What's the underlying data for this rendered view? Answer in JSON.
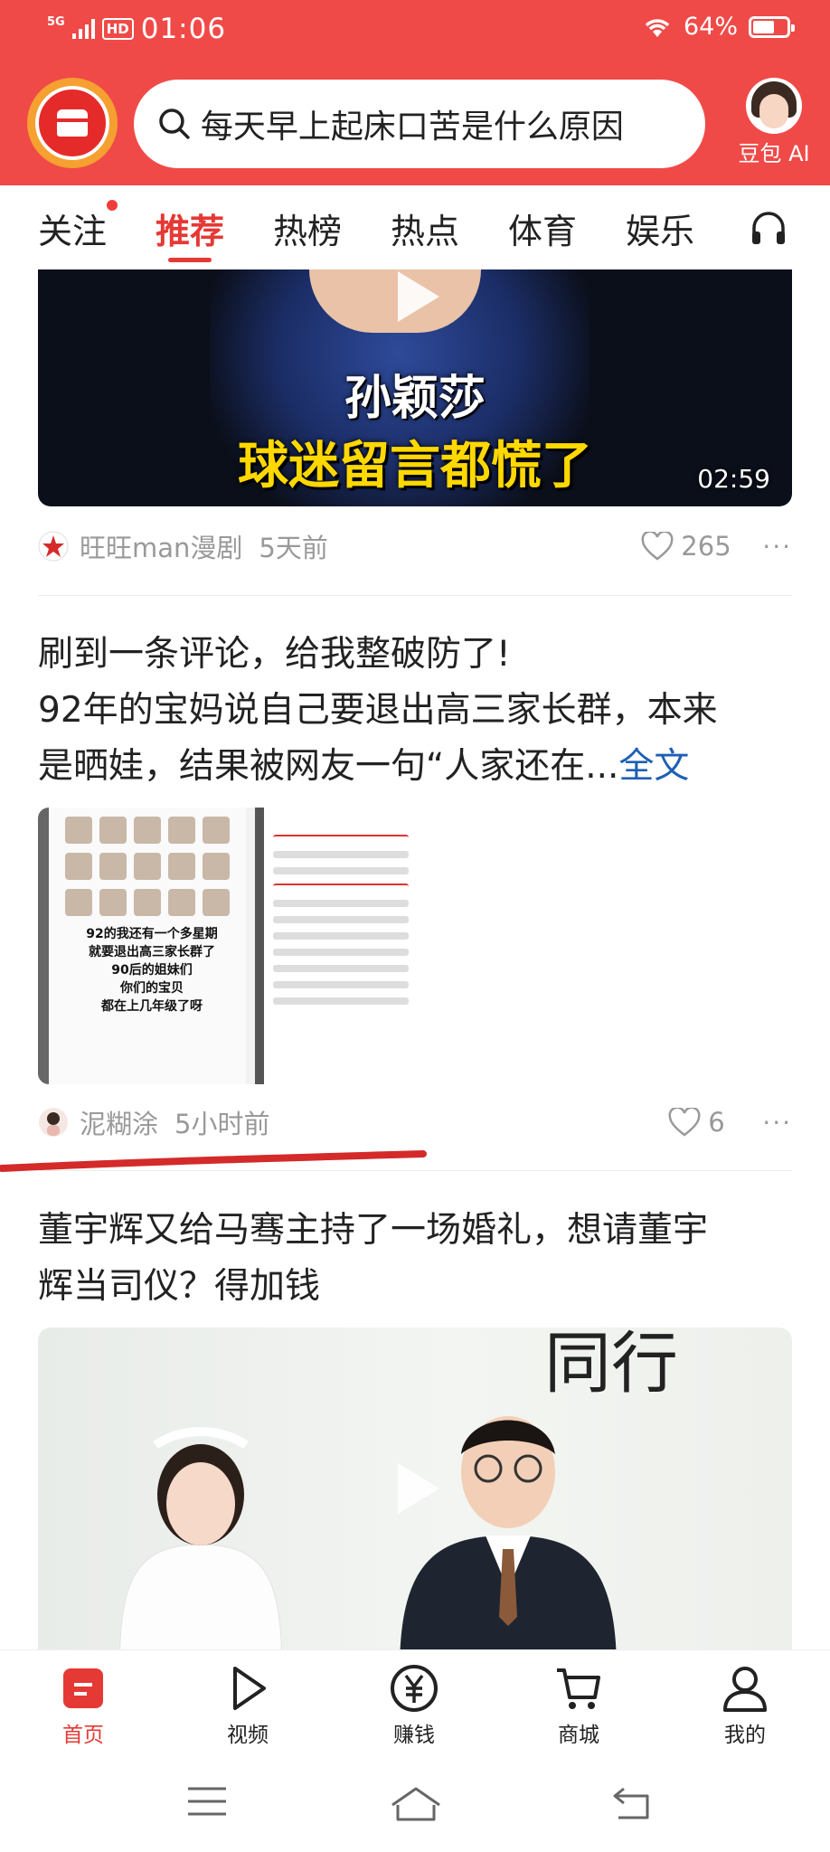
{
  "status_bar": {
    "network": "5G",
    "hd": "HD",
    "time": "01:06",
    "battery_percent": "64%",
    "battery_level": 0.64
  },
  "header": {
    "search_query": "每天早上起床口苦是什么原因",
    "ai_label": "豆包 AI"
  },
  "tabs": [
    {
      "label": "关注",
      "has_dot": true
    },
    {
      "label": "推荐",
      "active": true
    },
    {
      "label": "热榜"
    },
    {
      "label": "热点"
    },
    {
      "label": "体育"
    },
    {
      "label": "娱乐"
    }
  ],
  "feed": {
    "item1": {
      "overlay_line1": "孙颖莎",
      "overlay_line2": "球迷留言都慌了",
      "duration": "02:59",
      "author": "旺旺man漫剧",
      "time": "5天前",
      "likes": "265"
    },
    "item2": {
      "line1": "刷到一条评论，给我整破防了!",
      "line2": "92年的宝妈说自己要退出高三家长群，本来",
      "line3": "是晒娃，结果被网友一句“人家还在...",
      "full_link": "全文",
      "image_caption_1": "92的我还有一个多星期",
      "image_caption_2": "就要退出高三家长群了",
      "image_caption_3": "90后的姐妹们",
      "image_caption_4": "你们的宝贝",
      "image_caption_5": "都在上几年级了呀",
      "author": "泥糊涂",
      "time": "5小时前",
      "likes": "6"
    },
    "item3": {
      "line1": "董宇辉又给马骞主持了一场婚礼，想请董宇",
      "line2": "辉当司仪？得加钱",
      "calligraphy": "同行"
    }
  },
  "bottom_nav": [
    {
      "label": "首页",
      "icon": "home-icon",
      "active": true
    },
    {
      "label": "视频",
      "icon": "video-play-icon"
    },
    {
      "label": "赚钱",
      "icon": "yuan-coin-icon"
    },
    {
      "label": "商城",
      "icon": "shopping-cart-icon"
    },
    {
      "label": "我的",
      "icon": "profile-icon"
    }
  ],
  "colors": {
    "brand_red": "#f04a48",
    "active_tab": "#e53935",
    "link_blue": "#1e5fb4",
    "meta_gray": "#999999"
  }
}
